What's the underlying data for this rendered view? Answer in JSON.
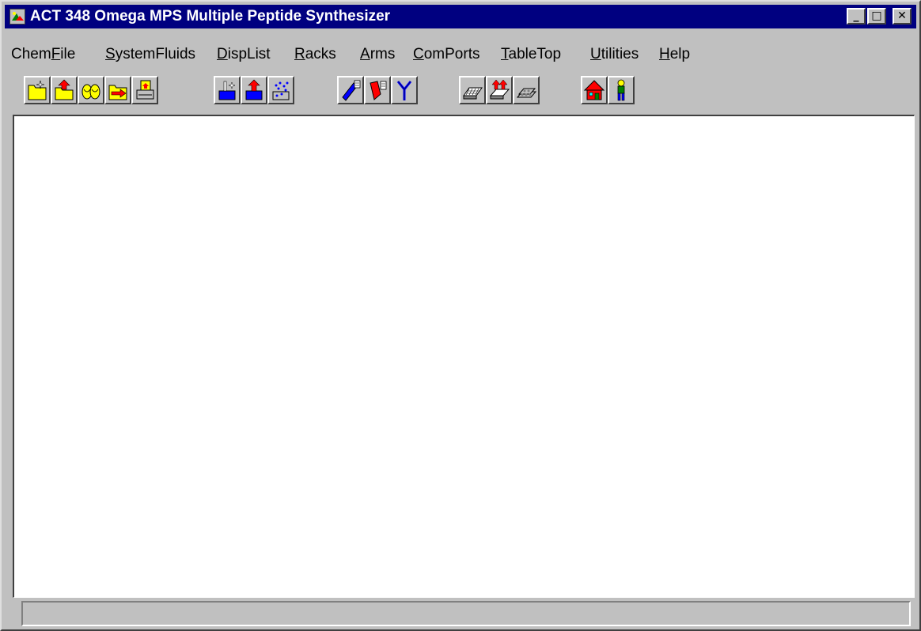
{
  "window": {
    "title": "ACT 348 Omega MPS Multiple Peptide Synthesizer",
    "controls": {
      "minimize": "_",
      "maximize": "□",
      "close": "✕"
    }
  },
  "menu": {
    "items": [
      {
        "label": "ChemFile",
        "accel": "F"
      },
      {
        "label": "SystemFluids",
        "accel": "S"
      },
      {
        "label": "DispList",
        "accel": "D"
      },
      {
        "label": "Racks",
        "accel": "R"
      },
      {
        "label": "Arms",
        "accel": "A"
      },
      {
        "label": "ComPorts",
        "accel": "C"
      },
      {
        "label": "TableTop",
        "accel": "T"
      },
      {
        "label": "Utilities",
        "accel": "U"
      },
      {
        "label": "Help",
        "accel": "H"
      }
    ]
  },
  "toolbar": {
    "buttons": [
      {
        "icon": "new-file-icon"
      },
      {
        "icon": "open-file-icon"
      },
      {
        "icon": "chemicals-icon"
      },
      {
        "icon": "export-file-icon"
      },
      {
        "icon": "print-icon"
      },
      {
        "icon": "fluid-add-icon"
      },
      {
        "icon": "fluid-up-icon"
      },
      {
        "icon": "fluid-spray-icon"
      },
      {
        "icon": "dispense-pen-icon"
      },
      {
        "icon": "dispense-marker-icon"
      },
      {
        "icon": "split-tube-icon"
      },
      {
        "icon": "rack-icon"
      },
      {
        "icon": "rack-up-icon"
      },
      {
        "icon": "rack-stack-icon"
      },
      {
        "icon": "home-icon"
      },
      {
        "icon": "person-icon"
      }
    ]
  },
  "statusbar": {
    "text": ""
  },
  "colors": {
    "title_bg": "#000080",
    "face": "#c0c0c0",
    "folder": "#ffff00",
    "arrow": "#ff0000",
    "fluid": "#0000ff"
  }
}
